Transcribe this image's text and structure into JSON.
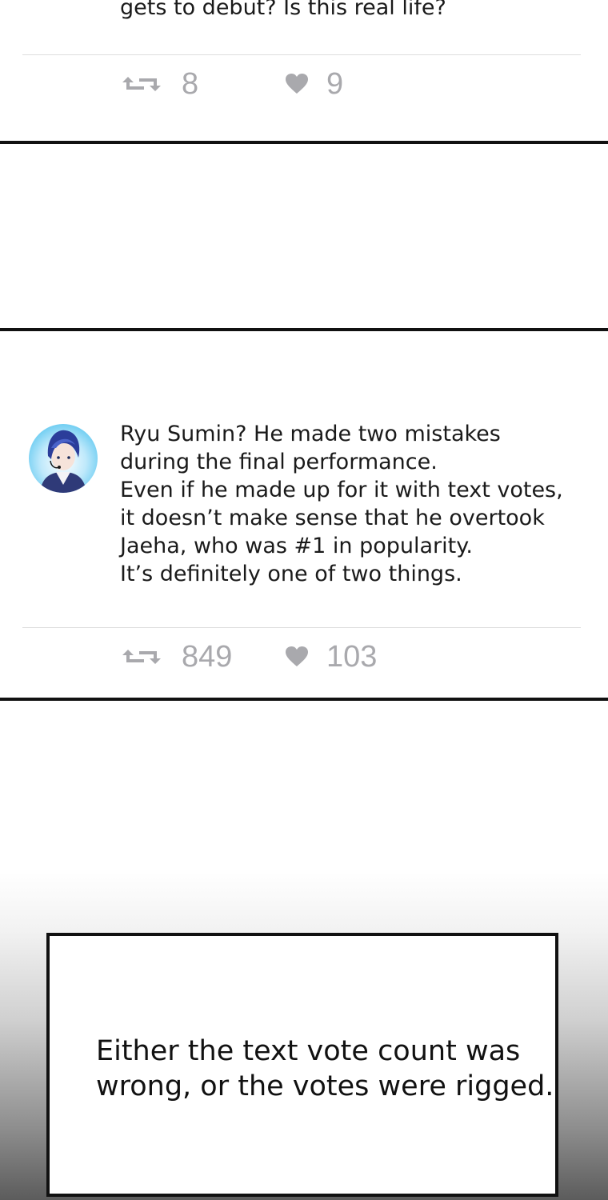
{
  "post1": {
    "text_partial": "gets to debut? Is this real life?",
    "retweets": "8",
    "likes": "9"
  },
  "post2": {
    "avatar_icon": "user-avatar-icon",
    "text": "Ryu Sumin? He made two mistakes\nduring the final performance.\nEven if he made up for it with text votes,\nit doesn’t make sense that he overtook\nJaeha, who was #1 in popularity.\nIt’s definitely one of two things.",
    "retweets": "849",
    "likes": "103"
  },
  "caption": {
    "text": "Either the text vote count was\nwrong, or the votes were rigged."
  },
  "icons": {
    "retweet": "retweet-icon",
    "like": "heart-icon"
  },
  "colors": {
    "stat": "#a9a9ad",
    "text": "#1a1a1a",
    "rule": "#111111"
  }
}
